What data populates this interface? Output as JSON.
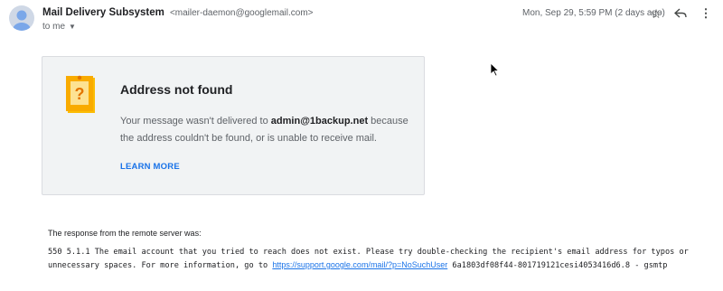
{
  "header": {
    "sender_name": "Mail Delivery Subsystem",
    "sender_email": "<mailer-daemon@googlemail.com>",
    "to_label": "to me",
    "date": "Mon, Sep 29, 5:59 PM (2 days ago)",
    "icons": [
      "avatar",
      "star-icon",
      "reply-icon",
      "more-vert-icon",
      "chevron-down-icon"
    ]
  },
  "card": {
    "title": "Address not found",
    "message_prefix": "Your message wasn't delivered to",
    "recipient": "admin@1backup.net",
    "message_suffix": "because the address couldn't be found, or is unable to receive mail.",
    "learn_more": "LEARN MORE",
    "icon": "question-document-icon",
    "accent_color": "#f9a825"
  },
  "response": {
    "label": "The response from the remote server was:",
    "text_before_link": "550 5.1.1 The email account that you tried to reach does not exist. Please try double-checking the recipient's email address for typos or unnecessary spaces. For more information, go to",
    "link": "https://support.google.com/mail/?p=NoSuchUser",
    "text_after_link": "6a1803df08f44-801719121cesi4053416d6.8 - gsmtp"
  }
}
